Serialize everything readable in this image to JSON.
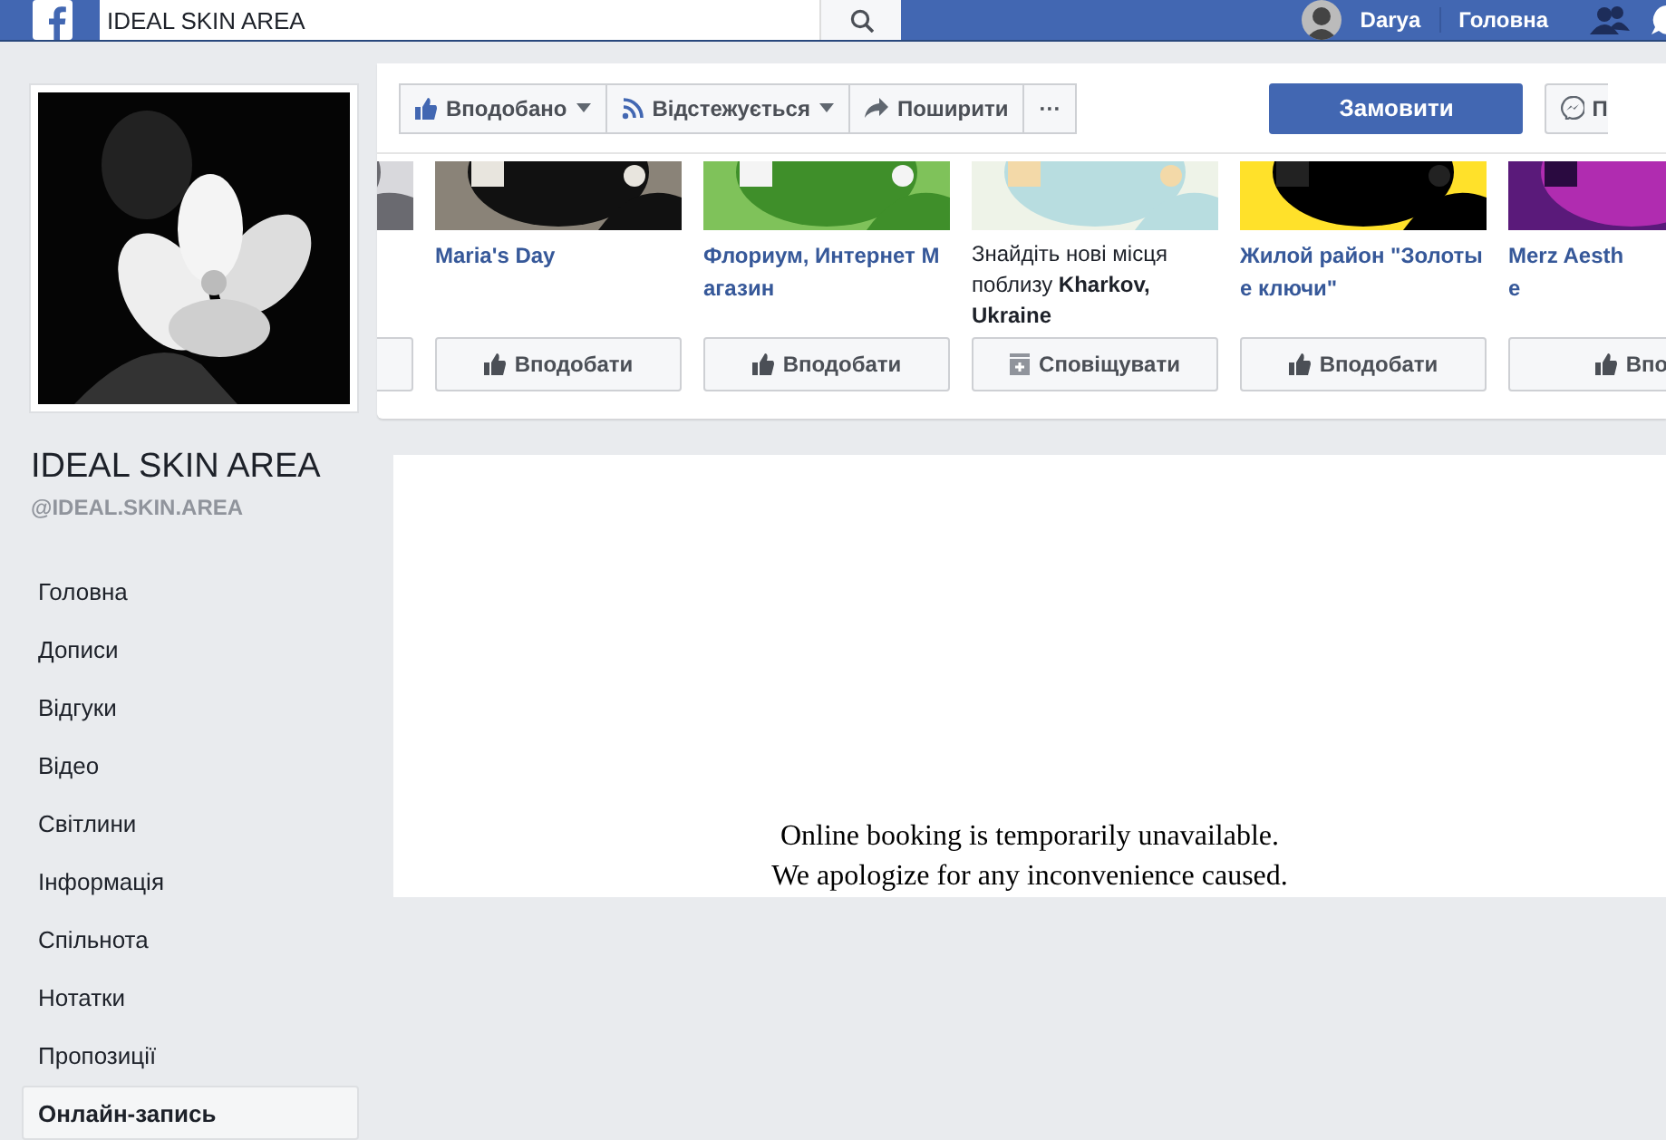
{
  "topbar": {
    "search": {
      "value": "IDEAL SKIN AREA"
    },
    "user": "Darya",
    "home": "Головна"
  },
  "page": {
    "name": "IDEAL SKIN AREA",
    "handle": "@IDEAL.SKIN.AREA"
  },
  "nav": [
    {
      "label": "Головна",
      "selected": false
    },
    {
      "label": "Дописи",
      "selected": false
    },
    {
      "label": "Відгуки",
      "selected": false
    },
    {
      "label": "Відео",
      "selected": false
    },
    {
      "label": "Світлини",
      "selected": false
    },
    {
      "label": "Інформація",
      "selected": false
    },
    {
      "label": "Спільнота",
      "selected": false
    },
    {
      "label": "Нотатки",
      "selected": false
    },
    {
      "label": "Пропозиції",
      "selected": false
    },
    {
      "label": "Онлайн-запись",
      "selected": true
    }
  ],
  "actions": [
    {
      "label": "Вподобано",
      "menu": true
    },
    {
      "label": "Відстежується",
      "menu": true
    },
    {
      "label": "Поширити",
      "menu": false
    },
    {
      "label": "···",
      "menu": false
    }
  ],
  "primary_button": "Замовити",
  "message_button": "П",
  "cards": [
    {
      "kind": "blank"
    },
    {
      "kind": "page",
      "title_lines": [
        "Maria's Day"
      ],
      "button": "Вподобати"
    },
    {
      "kind": "page",
      "title_lines": [
        "Флориум, Интернет М",
        "агазин"
      ],
      "button": "Вподобати"
    },
    {
      "kind": "places",
      "text": "Знайдіть нові місця поблизу **Kharkov, Ukraine**",
      "button": "Сповіщувати"
    },
    {
      "kind": "page",
      "title_lines": [
        "Жилой район \"Золоты",
        "е ключи\""
      ],
      "button": "Вподобати"
    },
    {
      "kind": "page",
      "title_lines": [
        "Merz Aesth",
        "e"
      ],
      "button": "Впо"
    }
  ],
  "booking": [
    "Online booking is temporarily unavailable.",
    "We apologize for any inconvenience caused."
  ]
}
